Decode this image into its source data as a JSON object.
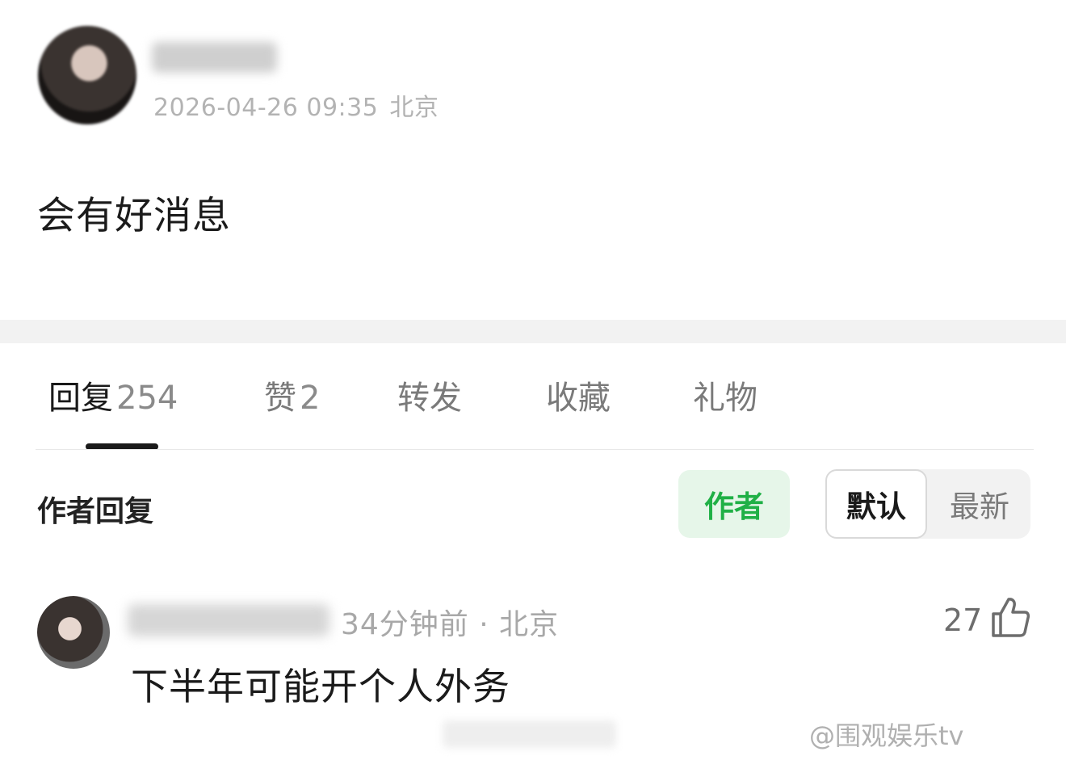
{
  "post": {
    "timestamp": "2026-04-26 09:35",
    "location": "北京",
    "content": "会有好消息"
  },
  "tabs": [
    {
      "label": "回复",
      "count": "254"
    },
    {
      "label": "赞",
      "count": "2"
    },
    {
      "label": "转发",
      "count": ""
    },
    {
      "label": "收藏",
      "count": ""
    },
    {
      "label": "礼物",
      "count": ""
    }
  ],
  "filters": {
    "section_label": "作者回复",
    "author_chip": "作者",
    "sort_default": "默认",
    "sort_latest": "最新"
  },
  "reply": {
    "meta": "34分钟前 · 北京",
    "like_count": "27",
    "content": "下半年可能开个人外务"
  },
  "watermark": "@围观娱乐tv",
  "colors": {
    "accent_green": "#20b046",
    "chip_bg": "#e6f6e9"
  }
}
